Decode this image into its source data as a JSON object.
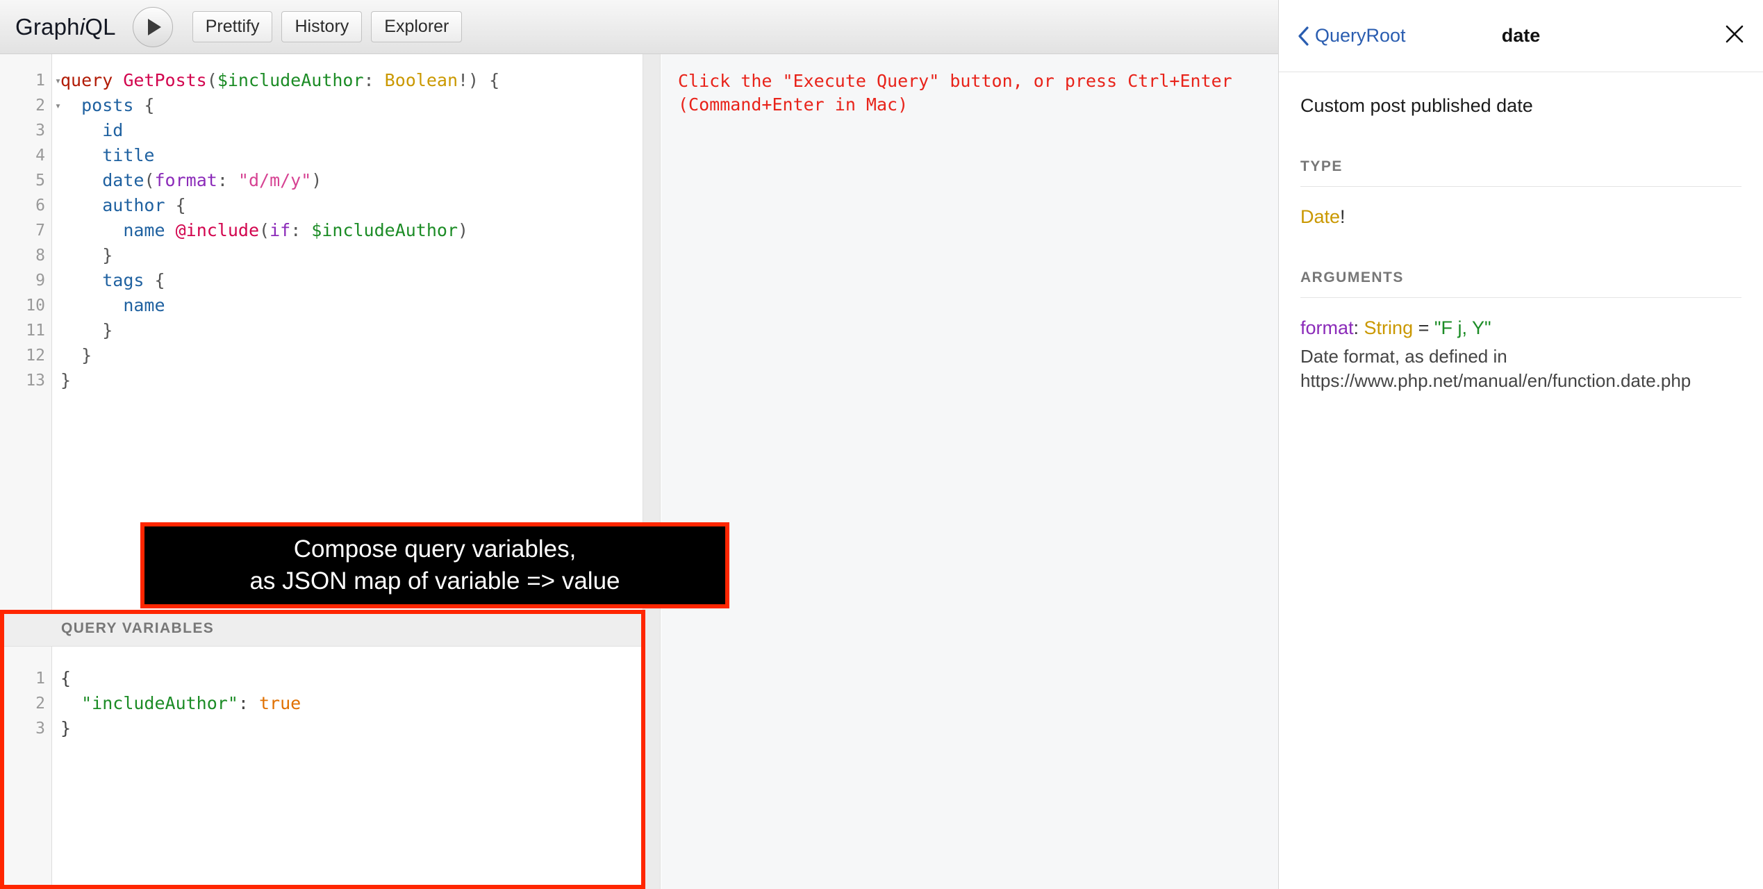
{
  "header": {
    "logo_prefix": "Graph",
    "logo_i": "i",
    "logo_suffix": "QL",
    "execute_title": "Execute Query (Ctrl-Enter)",
    "buttons": [
      {
        "label": "Prettify"
      },
      {
        "label": "History"
      },
      {
        "label": "Explorer"
      }
    ]
  },
  "query_editor": {
    "line_numbers": [
      "1",
      "2",
      "3",
      "4",
      "5",
      "6",
      "7",
      "8",
      "9",
      "10",
      "11",
      "12",
      "13"
    ],
    "fold_lines": [
      1,
      2
    ],
    "lines": [
      [
        {
          "t": "query",
          "c": "t-kw"
        },
        {
          "t": " ",
          "c": "t-punc"
        },
        {
          "t": "GetPosts",
          "c": "t-def"
        },
        {
          "t": "(",
          "c": "t-punc"
        },
        {
          "t": "$includeAuthor",
          "c": "t-var"
        },
        {
          "t": ": ",
          "c": "t-punc"
        },
        {
          "t": "Boolean",
          "c": "t-type"
        },
        {
          "t": "!) {",
          "c": "t-punc"
        }
      ],
      [
        {
          "t": "  ",
          "c": "t-punc"
        },
        {
          "t": "posts",
          "c": "t-prop"
        },
        {
          "t": " {",
          "c": "t-punc"
        }
      ],
      [
        {
          "t": "    ",
          "c": "t-punc"
        },
        {
          "t": "id",
          "c": "t-prop"
        }
      ],
      [
        {
          "t": "    ",
          "c": "t-punc"
        },
        {
          "t": "title",
          "c": "t-prop"
        }
      ],
      [
        {
          "t": "    ",
          "c": "t-punc"
        },
        {
          "t": "date",
          "c": "t-prop"
        },
        {
          "t": "(",
          "c": "t-punc"
        },
        {
          "t": "format",
          "c": "t-attr"
        },
        {
          "t": ": ",
          "c": "t-punc"
        },
        {
          "t": "\"d/m/y\"",
          "c": "t-str"
        },
        {
          "t": ")",
          "c": "t-punc"
        }
      ],
      [
        {
          "t": "    ",
          "c": "t-punc"
        },
        {
          "t": "author",
          "c": "t-prop"
        },
        {
          "t": " {",
          "c": "t-punc"
        }
      ],
      [
        {
          "t": "      ",
          "c": "t-punc"
        },
        {
          "t": "name",
          "c": "t-prop"
        },
        {
          "t": " ",
          "c": "t-punc"
        },
        {
          "t": "@include",
          "c": "t-meta"
        },
        {
          "t": "(",
          "c": "t-punc"
        },
        {
          "t": "if",
          "c": "t-attr"
        },
        {
          "t": ": ",
          "c": "t-punc"
        },
        {
          "t": "$includeAuthor",
          "c": "t-var"
        },
        {
          "t": ")",
          "c": "t-punc"
        }
      ],
      [
        {
          "t": "    }",
          "c": "t-punc"
        }
      ],
      [
        {
          "t": "    ",
          "c": "t-punc"
        },
        {
          "t": "tags",
          "c": "t-prop"
        },
        {
          "t": " {",
          "c": "t-punc"
        }
      ],
      [
        {
          "t": "      ",
          "c": "t-punc"
        },
        {
          "t": "name",
          "c": "t-prop"
        }
      ],
      [
        {
          "t": "    }",
          "c": "t-punc"
        }
      ],
      [
        {
          "t": "  }",
          "c": "t-punc"
        }
      ],
      [
        {
          "t": "}",
          "c": "t-punc"
        }
      ]
    ]
  },
  "result": {
    "message": "Click the \"Execute Query\" button, or press Ctrl+Enter\n(Command+Enter in Mac)"
  },
  "variables": {
    "title": "QUERY VARIABLES",
    "line_numbers": [
      "1",
      "2",
      "3"
    ],
    "lines": [
      [
        {
          "t": "{",
          "c": "j-punc"
        }
      ],
      [
        {
          "t": "  ",
          "c": "j-punc"
        },
        {
          "t": "\"includeAuthor\"",
          "c": "j-str"
        },
        {
          "t": ": ",
          "c": "j-punc"
        },
        {
          "t": "true",
          "c": "j-atom"
        }
      ],
      [
        {
          "t": "}",
          "c": "j-punc"
        }
      ]
    ]
  },
  "callout": {
    "line1": "Compose query variables,",
    "line2": "as JSON map of variable => value",
    "border_color": "#ff2600",
    "background": "#000000"
  },
  "highlight": {
    "color": "#ff2600"
  },
  "docs": {
    "back_label": "QueryRoot",
    "back_chevron": "‹",
    "title": "date",
    "close_glyph": "✕",
    "description": "Custom post published date",
    "type_section_label": "TYPE",
    "type_name": "Date",
    "type_nonnull": "!",
    "arguments_section_label": "ARGUMENTS",
    "argument": {
      "name": "format",
      "colon": ": ",
      "type": "String",
      "equals": " = ",
      "default": "\"F j, Y\"",
      "description": "Date format, as defined in https://www.php.net/manual/en/function.date.php"
    }
  }
}
